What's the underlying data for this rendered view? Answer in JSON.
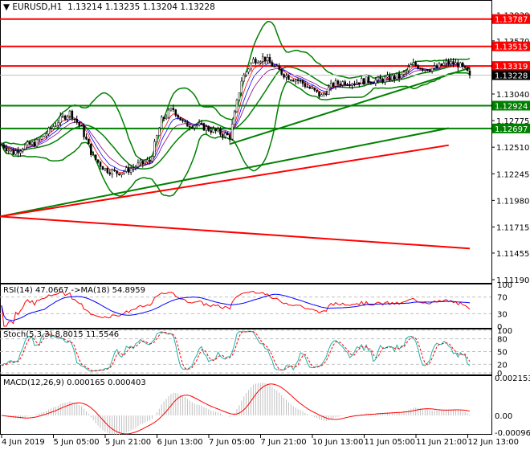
{
  "header": {
    "symbol": "EURUSD,H1",
    "open": "1.13214",
    "high": "1.13235",
    "low": "1.13204",
    "close": "1.13228"
  },
  "chart_data": {
    "type": "candlestick",
    "title": "EURUSD,H1 1.13214 1.13235 1.13204 1.13228",
    "price_axis_ticks": [
      "1.13830",
      "1.13570",
      "1.13305",
      "1.13040",
      "1.12775",
      "1.12510",
      "1.12245",
      "1.11980",
      "1.11715",
      "1.11455",
      "1.11190"
    ],
    "price_range": [
      1.1119,
      1.1402
    ],
    "levels": [
      {
        "label": "1.13787",
        "value": 1.13787,
        "color": "#ff0000"
      },
      {
        "label": "1.13515",
        "value": 1.13515,
        "color": "#ff0000"
      },
      {
        "label": "1.13319",
        "value": 1.13319,
        "color": "#ff0000"
      },
      {
        "label": "1.12924",
        "value": 1.12924,
        "color": "#008000"
      },
      {
        "label": "1.12697",
        "value": 1.12697,
        "color": "#008000"
      }
    ],
    "current_price": {
      "label": "1.13228",
      "value": 1.13228
    },
    "closes": [
      1.12536,
      1.12455,
      1.1252,
      1.12552,
      1.12656,
      1.12776,
      1.12856,
      1.12696,
      1.12415,
      1.12295,
      1.12255,
      1.12279,
      1.12335,
      1.12375,
      1.12776,
      1.12896,
      1.12736,
      1.12736,
      1.12696,
      1.12656,
      1.12616,
      1.13176,
      1.13376,
      1.13401,
      1.13296,
      1.13216,
      1.13176,
      1.13096,
      1.13016,
      1.13136,
      1.1316,
      1.1316,
      1.13176,
      1.13176,
      1.132,
      1.13216,
      1.13336,
      1.13296,
      1.13296,
      1.13352,
      1.13336,
      1.13228
    ],
    "trendlines": [
      {
        "name": "green-trendline",
        "color": "#008000",
        "from": [
          0.49,
          1.1254
        ],
        "to": [
          1.0,
          1.133
        ]
      },
      {
        "name": "red-trendline",
        "color": "#ff0000",
        "from": [
          0.0,
          1.1182
        ],
        "to": [
          1.0,
          1.115
        ]
      },
      {
        "name": "green-moving-average",
        "color": "#008000",
        "from": [
          0.0,
          1.1182
        ],
        "to": [
          0.955,
          1.127
        ]
      },
      {
        "name": "red-moving-average",
        "color": "#ff0000",
        "from": [
          0.0,
          1.1182
        ],
        "to": [
          0.955,
          1.1253
        ]
      }
    ],
    "time_labels": [
      "4 Jun 2019",
      "5 Jun 05:00",
      "5 Jun 21:00",
      "6 Jun 13:00",
      "7 Jun 05:00",
      "7 Jun 21:00",
      "10 Jun 13:00",
      "11 Jun 05:00",
      "11 Jun 21:00",
      "12 Jun 13:00"
    ],
    "rsi": {
      "label": "RSI(14) 47.0667  ->MA(18) 54.8959",
      "ticks": [
        "100",
        "70",
        "30",
        "0"
      ]
    },
    "stoch": {
      "label": "Stoch(5,3,3) 8.8015 11.5546",
      "ticks": [
        "100",
        "80",
        "50",
        "20",
        "0"
      ]
    },
    "macd": {
      "label": "MACD(12,26,9) 0.000165 0.000403",
      "ticks": [
        "0.002153",
        "0.00",
        "-0.000963"
      ],
      "range": [
        -0.000963,
        0.002153
      ]
    }
  }
}
